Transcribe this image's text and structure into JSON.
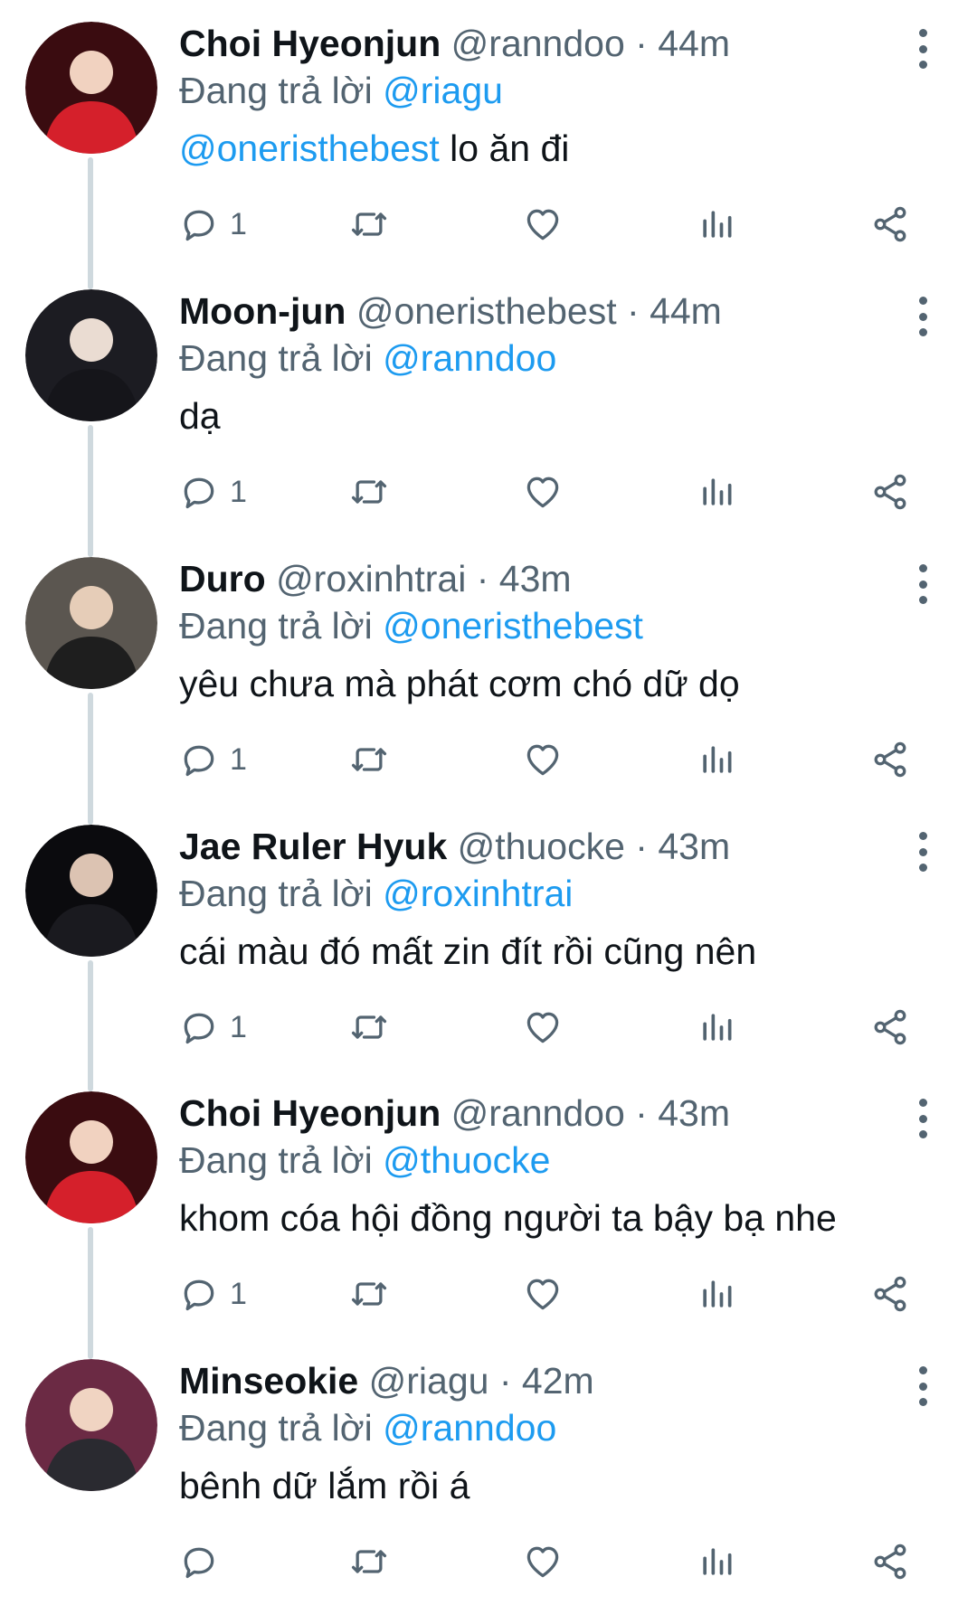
{
  "reply_prefix": "Đang trả lời",
  "dot": "·",
  "colors": {
    "mention": "#1d9bf0",
    "secondary_text": "#536471",
    "thread_line": "#cfd9de"
  },
  "icons": {
    "reply": "reply-icon",
    "retweet": "retweet-icon",
    "like": "heart-icon",
    "views": "views-icon",
    "share": "share-icon",
    "more": "more-options-icon"
  },
  "tweets": [
    {
      "name": "Choi Hyeonjun",
      "handle": "@ranndoo",
      "time": "44m",
      "reply_to": "@riagu",
      "text_mention": "@oneristhebest",
      "text": " lo ăn đi",
      "reply_count": "1"
    },
    {
      "name": "Moon-jun",
      "handle": "@oneristhebest",
      "time": "44m",
      "reply_to": "@ranndoo",
      "text_mention": "",
      "text": "dạ",
      "reply_count": "1"
    },
    {
      "name": "Duro",
      "handle": "@roxinhtrai",
      "time": "43m",
      "reply_to": "@oneristhebest",
      "text_mention": "",
      "text": "yêu chưa mà phát cơm chó dữ dọ",
      "reply_count": "1"
    },
    {
      "name": "Jae Ruler Hyuk",
      "handle": "@thuocke",
      "time": "43m",
      "reply_to": "@roxinhtrai",
      "text_mention": "",
      "text": "cái màu đó mất zin đít rồi cũng nên",
      "reply_count": "1"
    },
    {
      "name": "Choi Hyeonjun",
      "handle": "@ranndoo",
      "time": "43m",
      "reply_to": "@thuocke",
      "text_mention": "",
      "text": "khom cóa hội đồng người ta bậy bạ nhe",
      "reply_count": "1"
    },
    {
      "name": "Minseokie",
      "handle": "@riagu",
      "time": "42m",
      "reply_to": "@ranndoo",
      "text_mention": "",
      "text": "bênh dữ lắm rồi á",
      "reply_count": ""
    }
  ]
}
